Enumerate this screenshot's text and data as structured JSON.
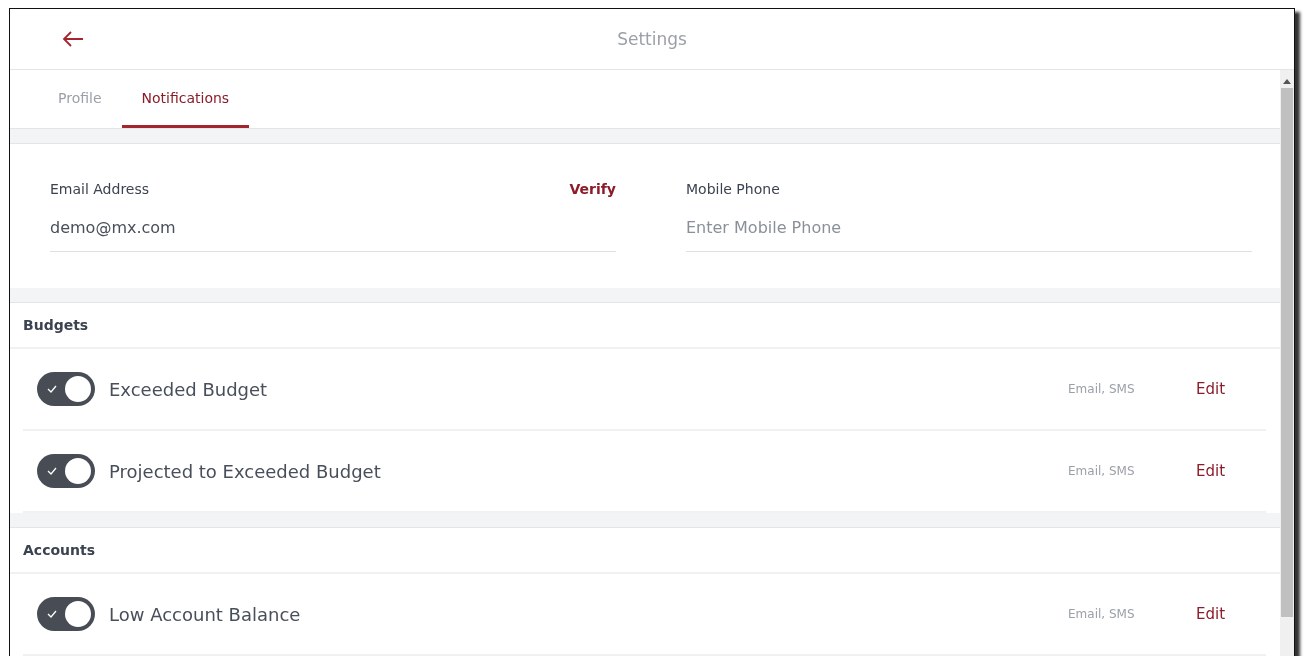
{
  "header": {
    "title": "Settings"
  },
  "tabs": [
    {
      "label": "Profile",
      "selected": false
    },
    {
      "label": "Notifications",
      "selected": true
    }
  ],
  "contact": {
    "email": {
      "label": "Email Address",
      "action": "Verify",
      "value": "demo@mx.com"
    },
    "phone": {
      "label": "Mobile Phone",
      "placeholder": "Enter Mobile Phone"
    }
  },
  "sections": [
    {
      "title": "Budgets",
      "items": [
        {
          "label": "Exceeded Budget",
          "on": true,
          "channels": "Email, SMS",
          "action": "Edit"
        },
        {
          "label": "Projected to Exceeded Budget",
          "on": true,
          "channels": "Email, SMS",
          "action": "Edit"
        }
      ]
    },
    {
      "title": "Accounts",
      "items": [
        {
          "label": "Low Account Balance",
          "on": true,
          "channels": "Email, SMS",
          "action": "Edit"
        }
      ]
    }
  ]
}
